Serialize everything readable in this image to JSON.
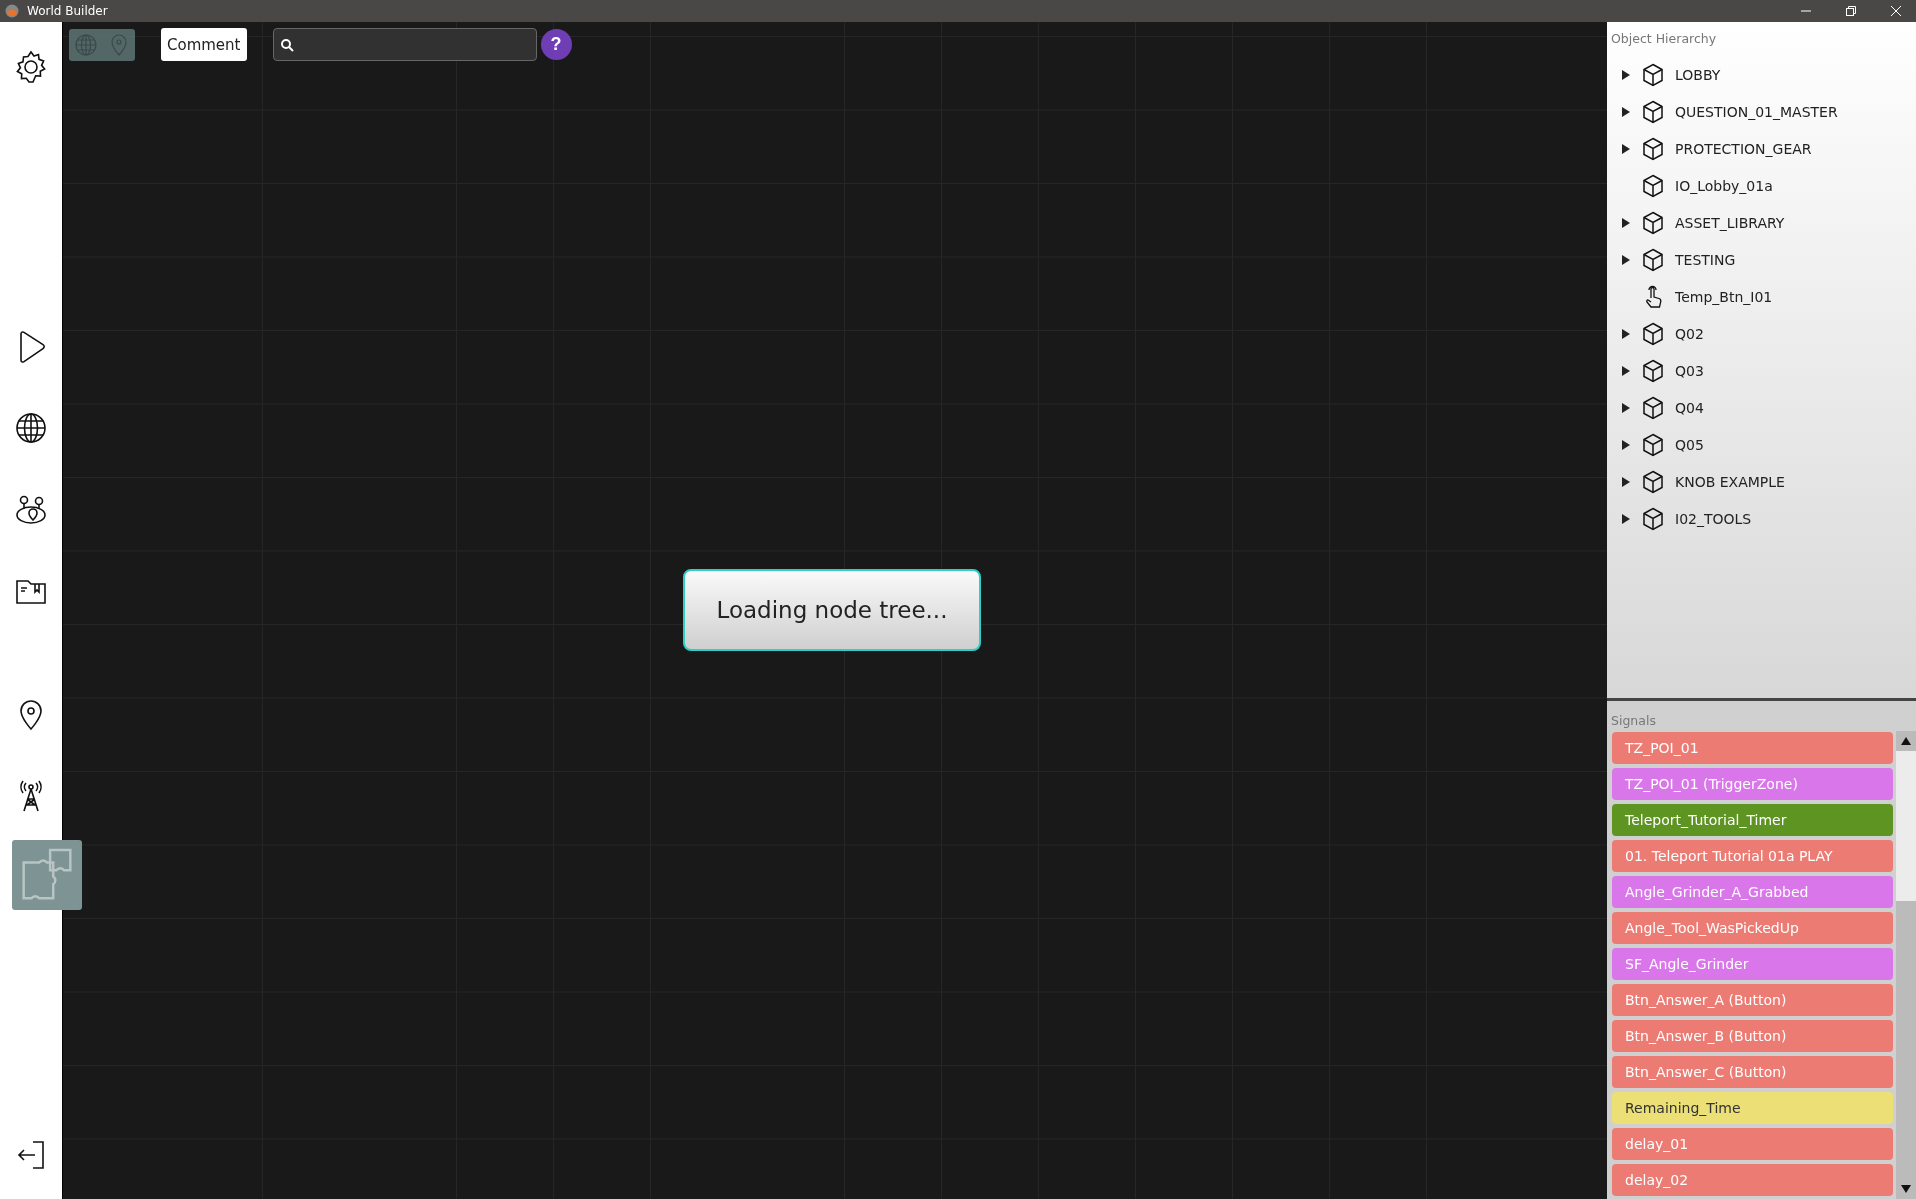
{
  "window": {
    "title": "World Builder"
  },
  "sidebar": {
    "items": [
      {
        "selected": false
      },
      {
        "selected": false
      },
      {
        "selected": false
      },
      {
        "selected": false
      },
      {
        "selected": false
      },
      {
        "selected": false
      },
      {
        "selected": false
      },
      {
        "selected": true
      },
      {
        "selected": false
      }
    ]
  },
  "toolbar": {
    "view_toggle": {
      "enabled": false
    },
    "comment_button": "Comment",
    "help_button": "?"
  },
  "canvas": {
    "loading_message": "Loading node tree..."
  },
  "object_hierarchy": {
    "title": "Object Hierarchy",
    "items": [
      {
        "label": "LOBBY",
        "kind": "object",
        "has_children": true
      },
      {
        "label": "QUESTION_01_MASTER",
        "kind": "object",
        "has_children": true
      },
      {
        "label": "PROTECTION_GEAR",
        "kind": "object",
        "has_children": true
      },
      {
        "label": "IO_Lobby_01a",
        "kind": "object",
        "has_children": false
      },
      {
        "label": "ASSET_LIBRARY",
        "kind": "object",
        "has_children": true
      },
      {
        "label": "TESTING",
        "kind": "object",
        "has_children": true
      },
      {
        "label": "Temp_Btn_I01",
        "kind": "button",
        "has_children": false
      },
      {
        "label": "Q02",
        "kind": "object",
        "has_children": true
      },
      {
        "label": "Q03",
        "kind": "object",
        "has_children": true
      },
      {
        "label": "Q04",
        "kind": "object",
        "has_children": true
      },
      {
        "label": "Q05",
        "kind": "object",
        "has_children": true
      },
      {
        "label": "KNOB EXAMPLE",
        "kind": "object",
        "has_children": true
      },
      {
        "label": "I02_TOOLS",
        "kind": "object",
        "has_children": true
      }
    ]
  },
  "signals": {
    "title": "Signals",
    "items": [
      {
        "label": "TZ_POI_01",
        "color": "#ec7b73"
      },
      {
        "label": "TZ_POI_01 (TriggerZone)",
        "color": "#d977ea"
      },
      {
        "label": "Teleport_Tutorial_Timer",
        "color": "#5e9421"
      },
      {
        "label": "01. Teleport Tutorial 01a PLAY",
        "color": "#ec7b73"
      },
      {
        "label": "Angle_Grinder_A_Grabbed",
        "color": "#d977ea"
      },
      {
        "label": "Angle_Tool_WasPickedUp",
        "color": "#ec7b73"
      },
      {
        "label": "SF_Angle_Grinder",
        "color": "#d977ea"
      },
      {
        "label": "Btn_Answer_A (Button)",
        "color": "#ec7b73"
      },
      {
        "label": "Btn_Answer_B (Button)",
        "color": "#ec7b73"
      },
      {
        "label": "Btn_Answer_C (Button)",
        "color": "#ec7b73"
      },
      {
        "label": "Remaining_Time",
        "color": "#ebdf76"
      },
      {
        "label": "delay_01",
        "color": "#ec7b73"
      },
      {
        "label": "delay_02",
        "color": "#ec7b73"
      }
    ]
  }
}
